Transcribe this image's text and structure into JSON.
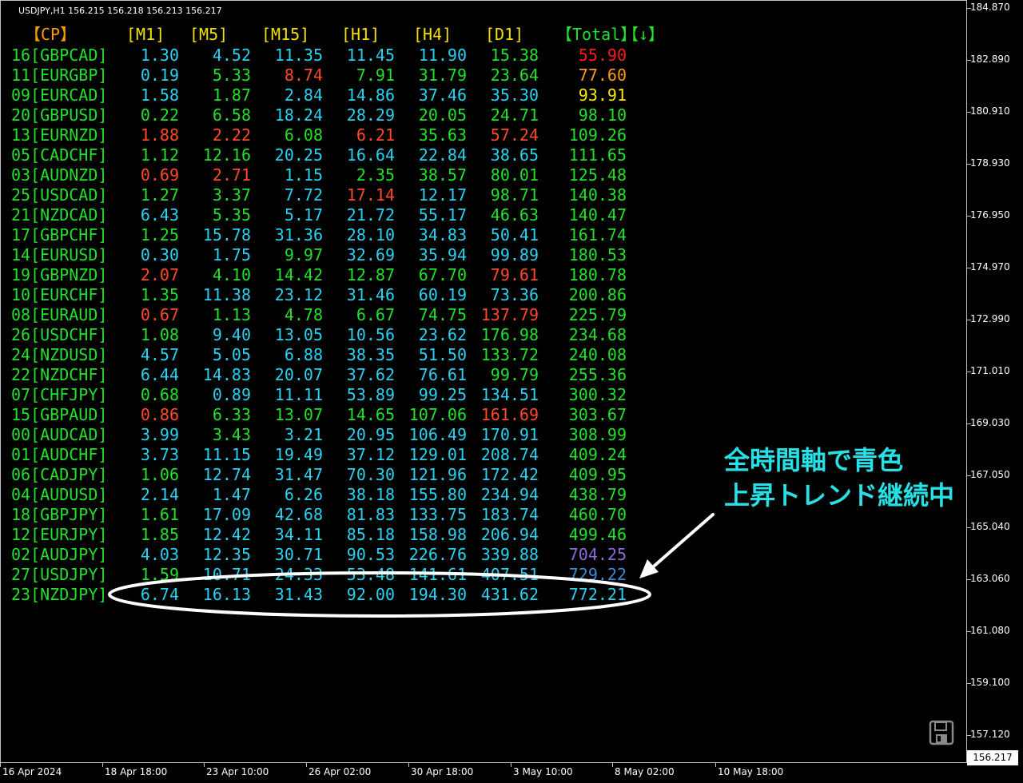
{
  "chart": {
    "symbol_info": "USDJPY,H1  156.215 156.218 156.213 156.217",
    "current_price": "156.217"
  },
  "colors": {
    "green": "#22e12a",
    "cyan": "#29d2f0",
    "red": "#ff4a2a",
    "orange_header": "#ff9a00",
    "yellow_header": "#f2e100",
    "total_red": "#ff1b1b",
    "total_orange": "#ff9a18",
    "total_yellow": "#ffea00",
    "total_purple": "#8f6ad6",
    "total_blue": "#3d8bd0",
    "annotation": "#27e0e6"
  },
  "table": {
    "headers": {
      "cp": "【CP】",
      "m1": "[M1]",
      "m5": "[M5]",
      "m15": "[M15]",
      "h1": "[H1]",
      "h4": "[H4]",
      "d1": "[D1]",
      "total": "【Total】",
      "sort": "【↓】"
    },
    "rows": [
      {
        "pair": "16[GBPCAD]",
        "m1": "1.30",
        "m5": "4.52",
        "m15": "11.35",
        "h1": "11.45",
        "h4": "11.90",
        "d1": "15.38",
        "total": "55.90",
        "c": [
          "cyan",
          "cyan",
          "cyan",
          "cyan",
          "cyan",
          "green"
        ],
        "tc": "total_red"
      },
      {
        "pair": "11[EURGBP]",
        "m1": "0.19",
        "m5": "5.33",
        "m15": "8.74",
        "h1": "7.91",
        "h4": "31.79",
        "d1": "23.64",
        "total": "77.60",
        "c": [
          "cyan",
          "green",
          "red",
          "green",
          "green",
          "green"
        ],
        "tc": "total_orange"
      },
      {
        "pair": "09[EURCAD]",
        "m1": "1.58",
        "m5": "1.87",
        "m15": "2.84",
        "h1": "14.86",
        "h4": "37.46",
        "d1": "35.30",
        "total": "93.91",
        "c": [
          "cyan",
          "green",
          "cyan",
          "cyan",
          "cyan",
          "cyan"
        ],
        "tc": "total_yellow"
      },
      {
        "pair": "20[GBPUSD]",
        "m1": "0.22",
        "m5": "6.58",
        "m15": "18.24",
        "h1": "28.29",
        "h4": "20.05",
        "d1": "24.71",
        "total": "98.10",
        "c": [
          "green",
          "green",
          "cyan",
          "cyan",
          "green",
          "green"
        ],
        "tc": "green"
      },
      {
        "pair": "13[EURNZD]",
        "m1": "1.88",
        "m5": "2.22",
        "m15": "6.08",
        "h1": "6.21",
        "h4": "35.63",
        "d1": "57.24",
        "total": "109.26",
        "c": [
          "red",
          "red",
          "green",
          "red",
          "green",
          "red"
        ],
        "tc": "green"
      },
      {
        "pair": "05[CADCHF]",
        "m1": "1.12",
        "m5": "12.16",
        "m15": "20.25",
        "h1": "16.64",
        "h4": "22.84",
        "d1": "38.65",
        "total": "111.65",
        "c": [
          "green",
          "green",
          "cyan",
          "cyan",
          "cyan",
          "cyan"
        ],
        "tc": "green"
      },
      {
        "pair": "03[AUDNZD]",
        "m1": "0.69",
        "m5": "2.71",
        "m15": "1.15",
        "h1": "2.35",
        "h4": "38.57",
        "d1": "80.01",
        "total": "125.48",
        "c": [
          "red",
          "red",
          "cyan",
          "green",
          "green",
          "green"
        ],
        "tc": "green"
      },
      {
        "pair": "25[USDCAD]",
        "m1": "1.27",
        "m5": "3.37",
        "m15": "7.72",
        "h1": "17.14",
        "h4": "12.17",
        "d1": "98.71",
        "total": "140.38",
        "c": [
          "green",
          "green",
          "cyan",
          "red",
          "cyan",
          "green"
        ],
        "tc": "green"
      },
      {
        "pair": "21[NZDCAD]",
        "m1": "6.43",
        "m5": "5.35",
        "m15": "5.17",
        "h1": "21.72",
        "h4": "55.17",
        "d1": "46.63",
        "total": "140.47",
        "c": [
          "cyan",
          "green",
          "cyan",
          "cyan",
          "cyan",
          "green"
        ],
        "tc": "green"
      },
      {
        "pair": "17[GBPCHF]",
        "m1": "1.25",
        "m5": "15.78",
        "m15": "31.36",
        "h1": "28.10",
        "h4": "34.83",
        "d1": "50.41",
        "total": "161.74",
        "c": [
          "green",
          "cyan",
          "cyan",
          "cyan",
          "cyan",
          "cyan"
        ],
        "tc": "green"
      },
      {
        "pair": "14[EURUSD]",
        "m1": "0.30",
        "m5": "1.75",
        "m15": "9.97",
        "h1": "32.69",
        "h4": "35.94",
        "d1": "99.89",
        "total": "180.53",
        "c": [
          "cyan",
          "cyan",
          "green",
          "cyan",
          "cyan",
          "cyan"
        ],
        "tc": "green"
      },
      {
        "pair": "19[GBPNZD]",
        "m1": "2.07",
        "m5": "4.10",
        "m15": "14.42",
        "h1": "12.87",
        "h4": "67.70",
        "d1": "79.61",
        "total": "180.78",
        "c": [
          "red",
          "green",
          "green",
          "green",
          "green",
          "red"
        ],
        "tc": "green"
      },
      {
        "pair": "10[EURCHF]",
        "m1": "1.35",
        "m5": "11.38",
        "m15": "23.12",
        "h1": "31.46",
        "h4": "60.19",
        "d1": "73.36",
        "total": "200.86",
        "c": [
          "green",
          "cyan",
          "cyan",
          "cyan",
          "cyan",
          "cyan"
        ],
        "tc": "green"
      },
      {
        "pair": "08[EURAUD]",
        "m1": "0.67",
        "m5": "1.13",
        "m15": "4.78",
        "h1": "6.67",
        "h4": "74.75",
        "d1": "137.79",
        "total": "225.79",
        "c": [
          "red",
          "green",
          "green",
          "green",
          "green",
          "red"
        ],
        "tc": "green"
      },
      {
        "pair": "26[USDCHF]",
        "m1": "1.08",
        "m5": "9.40",
        "m15": "13.05",
        "h1": "10.56",
        "h4": "23.62",
        "d1": "176.98",
        "total": "234.68",
        "c": [
          "green",
          "cyan",
          "cyan",
          "cyan",
          "cyan",
          "green"
        ],
        "tc": "green"
      },
      {
        "pair": "24[NZDUSD]",
        "m1": "4.57",
        "m5": "5.05",
        "m15": "6.88",
        "h1": "38.35",
        "h4": "51.50",
        "d1": "133.72",
        "total": "240.08",
        "c": [
          "cyan",
          "cyan",
          "cyan",
          "cyan",
          "cyan",
          "green"
        ],
        "tc": "green"
      },
      {
        "pair": "22[NZDCHF]",
        "m1": "6.44",
        "m5": "14.83",
        "m15": "20.07",
        "h1": "37.62",
        "h4": "76.61",
        "d1": "99.79",
        "total": "255.36",
        "c": [
          "cyan",
          "cyan",
          "cyan",
          "cyan",
          "cyan",
          "green"
        ],
        "tc": "green"
      },
      {
        "pair": "07[CHFJPY]",
        "m1": "0.68",
        "m5": "0.89",
        "m15": "11.11",
        "h1": "53.89",
        "h4": "99.25",
        "d1": "134.51",
        "total": "300.32",
        "c": [
          "green",
          "cyan",
          "cyan",
          "cyan",
          "cyan",
          "cyan"
        ],
        "tc": "green"
      },
      {
        "pair": "15[GBPAUD]",
        "m1": "0.86",
        "m5": "6.33",
        "m15": "13.07",
        "h1": "14.65",
        "h4": "107.06",
        "d1": "161.69",
        "total": "303.67",
        "c": [
          "red",
          "green",
          "green",
          "green",
          "green",
          "red"
        ],
        "tc": "green"
      },
      {
        "pair": "00[AUDCAD]",
        "m1": "3.99",
        "m5": "3.43",
        "m15": "3.21",
        "h1": "20.95",
        "h4": "106.49",
        "d1": "170.91",
        "total": "308.99",
        "c": [
          "cyan",
          "green",
          "cyan",
          "cyan",
          "cyan",
          "cyan"
        ],
        "tc": "green"
      },
      {
        "pair": "01[AUDCHF]",
        "m1": "3.73",
        "m5": "11.15",
        "m15": "19.49",
        "h1": "37.12",
        "h4": "129.01",
        "d1": "208.74",
        "total": "409.24",
        "c": [
          "cyan",
          "cyan",
          "cyan",
          "cyan",
          "cyan",
          "cyan"
        ],
        "tc": "green"
      },
      {
        "pair": "06[CADJPY]",
        "m1": "1.06",
        "m5": "12.74",
        "m15": "31.47",
        "h1": "70.30",
        "h4": "121.96",
        "d1": "172.42",
        "total": "409.95",
        "c": [
          "green",
          "cyan",
          "cyan",
          "cyan",
          "cyan",
          "cyan"
        ],
        "tc": "green"
      },
      {
        "pair": "04[AUDUSD]",
        "m1": "2.14",
        "m5": "1.47",
        "m15": "6.26",
        "h1": "38.18",
        "h4": "155.80",
        "d1": "234.94",
        "total": "438.79",
        "c": [
          "cyan",
          "cyan",
          "cyan",
          "cyan",
          "cyan",
          "cyan"
        ],
        "tc": "green"
      },
      {
        "pair": "18[GBPJPY]",
        "m1": "1.61",
        "m5": "17.09",
        "m15": "42.68",
        "h1": "81.83",
        "h4": "133.75",
        "d1": "183.74",
        "total": "460.70",
        "c": [
          "green",
          "cyan",
          "cyan",
          "cyan",
          "cyan",
          "cyan"
        ],
        "tc": "green"
      },
      {
        "pair": "12[EURJPY]",
        "m1": "1.85",
        "m5": "12.42",
        "m15": "34.11",
        "h1": "85.18",
        "h4": "158.98",
        "d1": "206.94",
        "total": "499.46",
        "c": [
          "green",
          "cyan",
          "cyan",
          "cyan",
          "cyan",
          "cyan"
        ],
        "tc": "green"
      },
      {
        "pair": "02[AUDJPY]",
        "m1": "4.03",
        "m5": "12.35",
        "m15": "30.71",
        "h1": "90.53",
        "h4": "226.76",
        "d1": "339.88",
        "total": "704.25",
        "c": [
          "cyan",
          "cyan",
          "cyan",
          "cyan",
          "cyan",
          "cyan"
        ],
        "tc": "total_purple"
      },
      {
        "pair": "27[USDJPY]",
        "m1": "1.59",
        "m5": "10.71",
        "m15": "24.33",
        "h1": "53.48",
        "h4": "141.61",
        "d1": "407.51",
        "total": "729.22",
        "c": [
          "green",
          "cyan",
          "cyan",
          "cyan",
          "cyan",
          "cyan"
        ],
        "tc": "total_blue"
      },
      {
        "pair": "23[NZDJPY]",
        "m1": "6.74",
        "m5": "16.13",
        "m15": "31.43",
        "h1": "92.00",
        "h4": "194.30",
        "d1": "431.62",
        "total": "772.21",
        "c": [
          "cyan",
          "cyan",
          "cyan",
          "cyan",
          "cyan",
          "cyan"
        ],
        "tc": "cyan"
      }
    ]
  },
  "price_axis": [
    "184.870",
    "182.890",
    "180.910",
    "178.930",
    "176.950",
    "174.970",
    "172.990",
    "171.010",
    "169.030",
    "167.050",
    "165.040",
    "163.060",
    "161.080",
    "159.100",
    "157.120"
  ],
  "time_axis": [
    "16 Apr 2024",
    "18 Apr 18:00",
    "23 Apr 10:00",
    "26 Apr 02:00",
    "30 Apr 18:00",
    "3 May 10:00",
    "8 May 02:00",
    "10 May 18:00"
  ],
  "annotation": {
    "line1": "全時間軸で青色",
    "line2": "上昇トレンド継続中"
  },
  "icons": {
    "save": "save-icon"
  }
}
